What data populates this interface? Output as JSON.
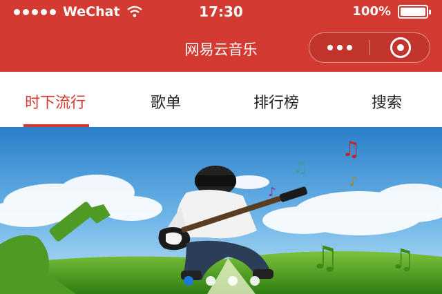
{
  "status_bar": {
    "carrier": "WeChat",
    "time": "17:30",
    "battery_text": "100%",
    "battery_level": 1.0
  },
  "nav": {
    "title": "网易云音乐",
    "icons": {
      "more": "more-dots-icon",
      "close": "close-circle-icon"
    }
  },
  "tabs": [
    {
      "label": "时下流行",
      "active": true
    },
    {
      "label": "歌单",
      "active": false
    },
    {
      "label": "排行榜",
      "active": false
    },
    {
      "label": "搜索",
      "active": false
    }
  ],
  "banner": {
    "slide_count": 4,
    "current_slide": 1
  },
  "colors": {
    "brand": "#d33a31",
    "indicator_active": "#1a7ad8"
  }
}
